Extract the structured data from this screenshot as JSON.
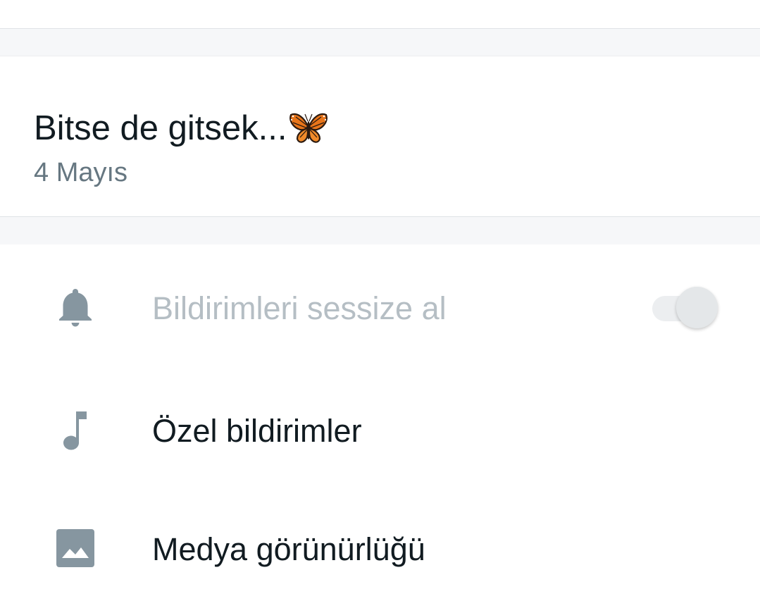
{
  "about": {
    "text": "Bitse de gitsek...",
    "emoji_icon": "butterfly-emoji",
    "date": "4 Mayıs"
  },
  "settings": {
    "mute": {
      "label": "Bildirimleri sessize al",
      "icon": "bell-icon",
      "enabled": false,
      "toggle_on": false
    },
    "custom_notifications": {
      "label": "Özel bildirimler",
      "icon": "music-note-icon"
    },
    "media_visibility": {
      "label": "Medya görünürlüğü",
      "icon": "image-icon"
    }
  },
  "colors": {
    "primary_text": "#111b21",
    "secondary_text": "#667781",
    "disabled_text": "#b5bec4",
    "icon_gray": "#8696a0",
    "section_gap": "#f6f7f9"
  }
}
